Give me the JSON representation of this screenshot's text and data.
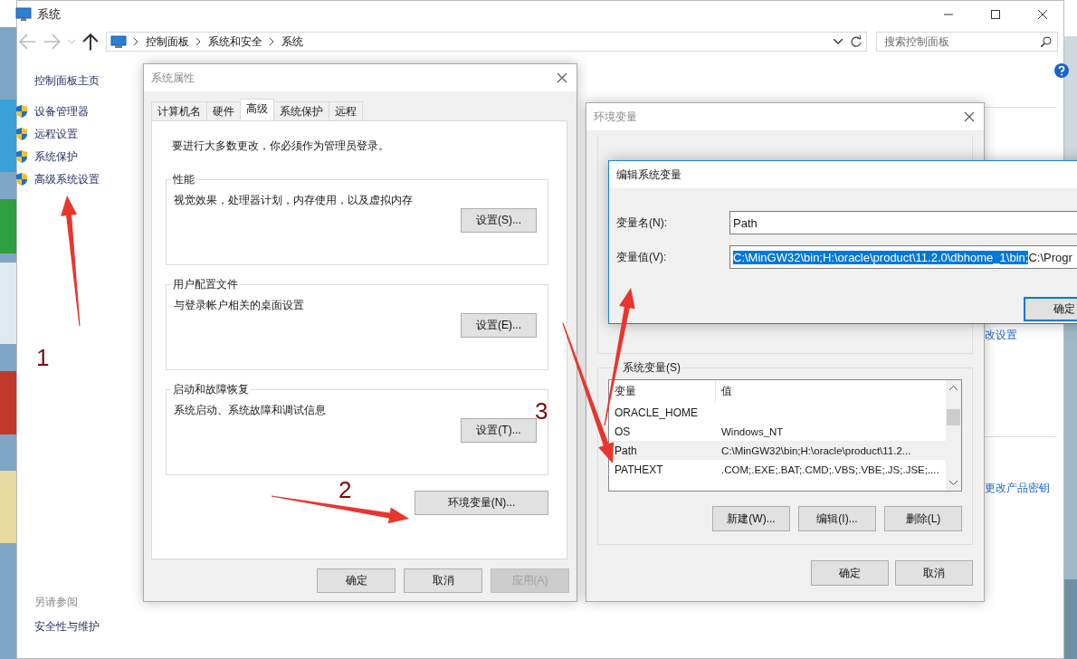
{
  "main_window": {
    "title": "系统",
    "breadcrumb": [
      "控制面板",
      "系统和安全",
      "系统"
    ],
    "search": {
      "placeholder": "搜索控制面板"
    },
    "sidebar": {
      "home": "控制面板主页",
      "items": [
        "设备管理器",
        "远程设置",
        "系统保护",
        "高级系统设置"
      ],
      "see_also": {
        "title": "另请参阅",
        "links": [
          "安全性与维护"
        ]
      }
    },
    "links": [
      "改设置",
      "更改产品密钥"
    ]
  },
  "system_properties": {
    "title": "系统属性",
    "tabs": [
      {
        "label": "计算机名",
        "selected": false
      },
      {
        "label": "硬件",
        "selected": false
      },
      {
        "label": "高级",
        "selected": true
      },
      {
        "label": "系统保护",
        "selected": false
      },
      {
        "label": "远程",
        "selected": false
      }
    ],
    "notice": "要进行大多数更改，你必须作为管理员登录。",
    "groups": [
      {
        "title": "性能",
        "description": "视觉效果，处理器计划，内存使用，以及虚拟内存",
        "button": "设置(S)..."
      },
      {
        "title": "用户配置文件",
        "description": "与登录帐户相关的桌面设置",
        "button": "设置(E)..."
      },
      {
        "title": "启动和故障恢复",
        "description": "系统启动、系统故障和调试信息",
        "button": "设置(T)..."
      }
    ],
    "env_button": "环境变量(N)...",
    "buttons": [
      {
        "label": "确定",
        "disabled": false
      },
      {
        "label": "取消",
        "disabled": false
      },
      {
        "label": "应用(A)",
        "disabled": true
      }
    ]
  },
  "environment_variables": {
    "title": "环境变量",
    "system_vars": {
      "title": "系统变量(S)",
      "columns": [
        "变量",
        "值"
      ],
      "rows": [
        {
          "name": "ORACLE_HOME",
          "value": "",
          "selected": false
        },
        {
          "name": "OS",
          "value": "Windows_NT",
          "selected": false
        },
        {
          "name": "Path",
          "value": "C:\\MinGW32\\bin;H:\\oracle\\product\\11.2...",
          "selected": true
        },
        {
          "name": "PATHEXT",
          "value": ".COM;.EXE;.BAT;.CMD;.VBS;.VBE;.JS;.JSE;....",
          "selected": false
        }
      ]
    },
    "actions": [
      "新建(W)...",
      "编辑(I)...",
      "删除(L)"
    ],
    "buttons": [
      "确定",
      "取消"
    ]
  },
  "edit_dialog": {
    "title": "编辑系统变量",
    "name_label": "变量名(N):",
    "name_value": "Path",
    "value_label": "变量值(V):",
    "value_selected": "C:\\MinGW32\\bin;H:\\oracle\\product\\11.2.0\\dbhome_1\\bin;",
    "value_rest": "C:\\Progr",
    "ok": "确定"
  },
  "annotations": [
    {
      "label": "1"
    },
    {
      "label": "2"
    },
    {
      "label": "3"
    }
  ]
}
